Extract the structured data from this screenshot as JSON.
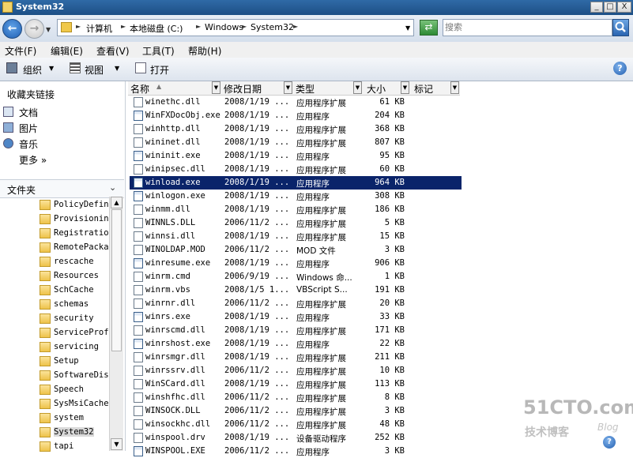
{
  "window": {
    "title": "System32",
    "min": "_",
    "max": "□",
    "close": "X"
  },
  "address": {
    "crumbs": [
      "计算机",
      "本地磁盘 (C:)",
      "Windows",
      "System32"
    ],
    "search_placeholder": "搜索"
  },
  "menu": [
    "文件(F)",
    "编辑(E)",
    "查看(V)",
    "工具(T)",
    "帮助(H)"
  ],
  "toolbar": {
    "organize": "组织",
    "views": "视图",
    "open": "打开"
  },
  "favorites": {
    "title": "收藏夹链接",
    "items": [
      "文档",
      "图片",
      "音乐"
    ],
    "more": "更多  »"
  },
  "folders": {
    "title": "文件夹",
    "items": [
      "PolicyDefinitions",
      "Provisioning",
      "Registration",
      "RemotePackages",
      "rescache",
      "Resources",
      "SchCache",
      "schemas",
      "security",
      "ServiceProfiles",
      "servicing",
      "Setup",
      "SoftwareDistribution",
      "Speech",
      "SysMsiCache",
      "system",
      "System32",
      "tapi"
    ],
    "selected": "System32"
  },
  "columns": {
    "name": "名称",
    "date": "修改日期",
    "type": "类型",
    "size": "大小",
    "tags": "标记"
  },
  "files": [
    {
      "name": "winethc.dll",
      "date": "2008/1/19 ...",
      "type": "应用程序扩展",
      "size": "61 KB",
      "icon": "dll-icon"
    },
    {
      "name": "WinFXDocObj.exe",
      "date": "2008/1/19 ...",
      "type": "应用程序",
      "size": "204 KB",
      "icon": "winfx-icon"
    },
    {
      "name": "winhttp.dll",
      "date": "2008/1/19 ...",
      "type": "应用程序扩展",
      "size": "368 KB",
      "icon": "dll-icon"
    },
    {
      "name": "wininet.dll",
      "date": "2008/1/19 ...",
      "type": "应用程序扩展",
      "size": "807 KB",
      "icon": "dll-icon"
    },
    {
      "name": "wininit.exe",
      "date": "2008/1/19 ...",
      "type": "应用程序",
      "size": "95 KB",
      "icon": "exe-icon"
    },
    {
      "name": "winipsec.dll",
      "date": "2008/1/19 ...",
      "type": "应用程序扩展",
      "size": "60 KB",
      "icon": "dll-icon"
    },
    {
      "name": "winload.exe",
      "date": "2008/1/19 ...",
      "type": "应用程序",
      "size": "964 KB",
      "icon": "exe-icon",
      "selected": true
    },
    {
      "name": "winlogon.exe",
      "date": "2008/1/19 ...",
      "type": "应用程序",
      "size": "308 KB",
      "icon": "winlogon-icon"
    },
    {
      "name": "winmm.dll",
      "date": "2008/1/19 ...",
      "type": "应用程序扩展",
      "size": "186 KB",
      "icon": "dll-icon"
    },
    {
      "name": "WINNLS.DLL",
      "date": "2006/11/2 ...",
      "type": "应用程序扩展",
      "size": "5 KB",
      "icon": "dll-icon"
    },
    {
      "name": "winnsi.dll",
      "date": "2008/1/19 ...",
      "type": "应用程序扩展",
      "size": "15 KB",
      "icon": "dll-icon"
    },
    {
      "name": "WINOLDAP.MOD",
      "date": "2006/11/2 ...",
      "type": "MOD 文件",
      "size": "3 KB",
      "icon": "file-icon"
    },
    {
      "name": "winresume.exe",
      "date": "2008/1/19 ...",
      "type": "应用程序",
      "size": "906 KB",
      "icon": "exe-icon"
    },
    {
      "name": "winrm.cmd",
      "date": "2006/9/19 ...",
      "type": "Windows 命...",
      "size": "1 KB",
      "icon": "cmd-icon"
    },
    {
      "name": "winrm.vbs",
      "date": "2008/1/5 1...",
      "type": "VBScript S...",
      "size": "191 KB",
      "icon": "vbs-icon"
    },
    {
      "name": "winrnr.dll",
      "date": "2006/11/2 ...",
      "type": "应用程序扩展",
      "size": "20 KB",
      "icon": "dll-icon"
    },
    {
      "name": "winrs.exe",
      "date": "2008/1/19 ...",
      "type": "应用程序",
      "size": "33 KB",
      "icon": "exe-icon"
    },
    {
      "name": "winrscmd.dll",
      "date": "2008/1/19 ...",
      "type": "应用程序扩展",
      "size": "171 KB",
      "icon": "dll-icon"
    },
    {
      "name": "winrshost.exe",
      "date": "2008/1/19 ...",
      "type": "应用程序",
      "size": "22 KB",
      "icon": "exe-icon"
    },
    {
      "name": "winrsmgr.dll",
      "date": "2008/1/19 ...",
      "type": "应用程序扩展",
      "size": "211 KB",
      "icon": "dll-icon"
    },
    {
      "name": "winrssrv.dll",
      "date": "2006/11/2 ...",
      "type": "应用程序扩展",
      "size": "10 KB",
      "icon": "dll-icon"
    },
    {
      "name": "WinSCard.dll",
      "date": "2008/1/19 ...",
      "type": "应用程序扩展",
      "size": "113 KB",
      "icon": "dll-icon"
    },
    {
      "name": "winshfhc.dll",
      "date": "2006/11/2 ...",
      "type": "应用程序扩展",
      "size": "8 KB",
      "icon": "dll-icon"
    },
    {
      "name": "WINSOCK.DLL",
      "date": "2006/11/2 ...",
      "type": "应用程序扩展",
      "size": "3 KB",
      "icon": "dll-icon"
    },
    {
      "name": "winsockhc.dll",
      "date": "2006/11/2 ...",
      "type": "应用程序扩展",
      "size": "48 KB",
      "icon": "dll-icon"
    },
    {
      "name": "winspool.drv",
      "date": "2008/1/19 ...",
      "type": "设备驱动程序",
      "size": "252 KB",
      "icon": "drv-icon"
    },
    {
      "name": "WINSPOOL.EXE",
      "date": "2006/11/2 ...",
      "type": "应用程序",
      "size": "3 KB",
      "icon": "exe-icon"
    }
  ],
  "watermark": {
    "line1": "51CTO.com",
    "line2": "技术博客",
    "line3": "Blog"
  },
  "help": "?"
}
